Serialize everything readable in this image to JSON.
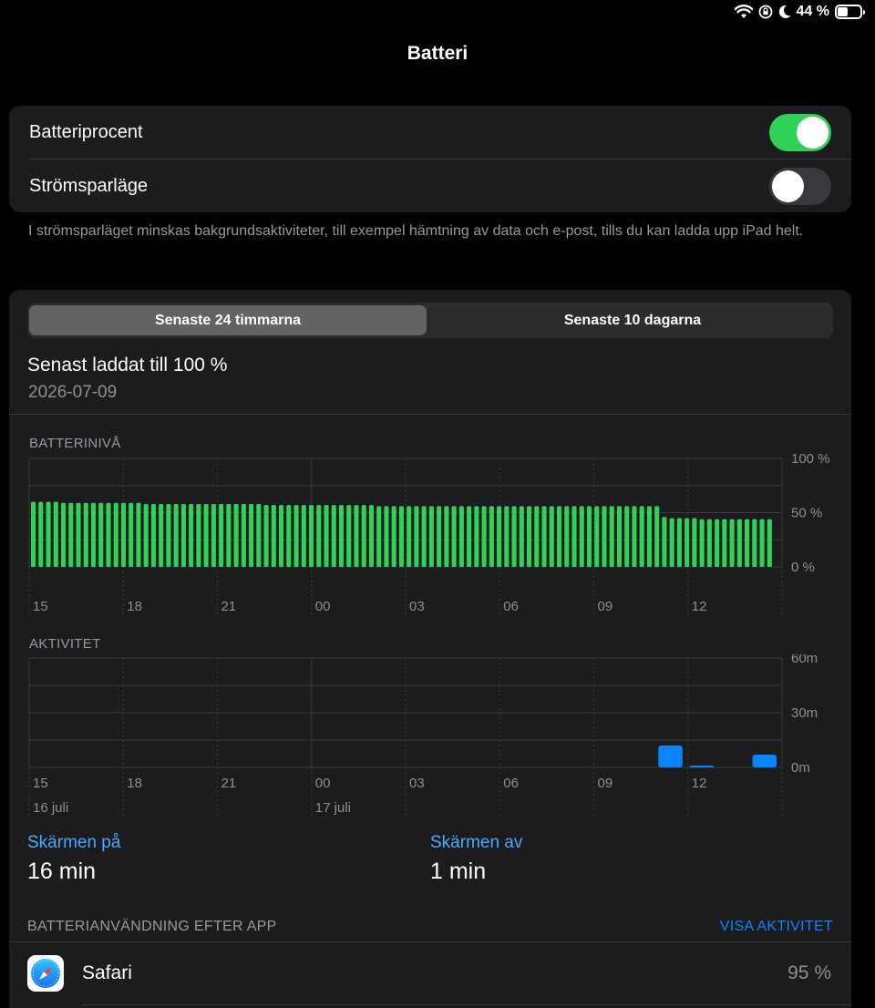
{
  "status_bar": {
    "battery_percent_text": "44 %",
    "battery_level": 0.44,
    "icons": [
      "wifi-icon",
      "rotation-lock-icon",
      "moon-icon",
      "battery-icon"
    ]
  },
  "nav": {
    "title": "Batteri"
  },
  "toggles": {
    "battery_percentage": {
      "label": "Batteriprocent",
      "on": true
    },
    "low_power": {
      "label": "Strömsparläge",
      "on": false
    }
  },
  "footnote": "I strömsparläget minskas bakgrundsaktiviteter, till exempel hämtning av data och e-post, tills du kan ladda upp iPad helt.",
  "segmented": {
    "left": "Senaste 24 timmarna",
    "right": "Senaste 10 dagarna",
    "selected": "left"
  },
  "last_charged": {
    "title": "Senast laddat till 100 %",
    "date": "2026-07-09"
  },
  "colors": {
    "battery_bar": "#30d158",
    "activity_bar": "#0a84ff",
    "link": "#0a84ff",
    "toggle_on": "#30d158"
  },
  "chart_data": [
    {
      "type": "bar",
      "title": "BATTERINIVÅ",
      "x_tick_labels": [
        "15",
        "18",
        "21",
        "00",
        "03",
        "06",
        "09",
        "12"
      ],
      "y_tick_labels": [
        "100 %",
        "50 %",
        "0 %"
      ],
      "ylim": [
        0,
        100
      ],
      "values": [
        60,
        60,
        60,
        60,
        59,
        59,
        59,
        59,
        59,
        59,
        59,
        59,
        59,
        59,
        59,
        58,
        58,
        58,
        58,
        58,
        58,
        58,
        58,
        58,
        58,
        58,
        58,
        58,
        58,
        58,
        58,
        57,
        57,
        57,
        57,
        57,
        57,
        57,
        57,
        57,
        57,
        57,
        57,
        57,
        57,
        57,
        56,
        56,
        56,
        56,
        56,
        56,
        56,
        56,
        56,
        56,
        56,
        56,
        56,
        56,
        56,
        56,
        56,
        56,
        56,
        56,
        56,
        56,
        56,
        56,
        56,
        56,
        56,
        56,
        56,
        56,
        56,
        56,
        56,
        56,
        56,
        56,
        56,
        56,
        46,
        45,
        45,
        45,
        45,
        44,
        44,
        44,
        44,
        44,
        44,
        44,
        44,
        44,
        44
      ]
    },
    {
      "type": "bar",
      "title": "AKTIVITET",
      "x_tick_labels": [
        "15",
        "18",
        "21",
        "00",
        "03",
        "06",
        "09",
        "12"
      ],
      "date_labels": [
        "16 juli",
        "17 juli"
      ],
      "y_tick_labels": [
        "60m",
        "30m",
        "0m"
      ],
      "ylim": [
        0,
        60
      ],
      "bars": [
        {
          "hour_index": 20,
          "minutes": 12
        },
        {
          "hour_index": 21,
          "minutes": 1
        },
        {
          "hour_index": 23,
          "minutes": 7
        }
      ]
    }
  ],
  "screen": {
    "on": {
      "label": "Skärmen på",
      "value": "16 min"
    },
    "off": {
      "label": "Skärmen av",
      "value": "1 min"
    }
  },
  "usage": {
    "header": "BATTERIANVÄNDNING EFTER APP",
    "action": "VISA AKTIVITET",
    "apps": [
      {
        "name": "Safari",
        "percent": "95 %",
        "icon": "safari-icon"
      }
    ]
  }
}
